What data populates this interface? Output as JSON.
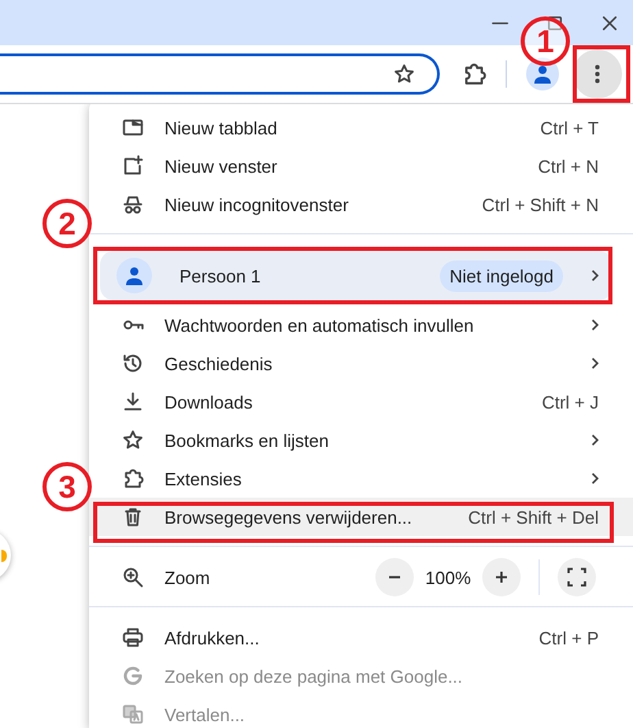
{
  "menu": {
    "items": [
      {
        "kind": "item",
        "label": "Nieuw tabblad",
        "shortcut": "Ctrl + T",
        "submenu": false,
        "highlighted": false,
        "disabled": false
      },
      {
        "kind": "item",
        "label": "Nieuw venster",
        "shortcut": "Ctrl + N",
        "submenu": false,
        "highlighted": false,
        "disabled": false
      },
      {
        "kind": "item",
        "label": "Nieuw incognitovenster",
        "shortcut": "Ctrl + Shift + N",
        "submenu": false,
        "highlighted": false,
        "disabled": false
      },
      {
        "kind": "divider"
      },
      {
        "kind": "profile",
        "name": "Persoon 1",
        "status": "Niet ingelogd",
        "submenu": true
      },
      {
        "kind": "item",
        "label": "Wachtwoorden en automatisch invullen",
        "submenu": true,
        "highlighted": false,
        "disabled": false
      },
      {
        "kind": "item",
        "label": "Geschiedenis",
        "submenu": true,
        "highlighted": false,
        "disabled": false
      },
      {
        "kind": "item",
        "label": "Downloads",
        "shortcut": "Ctrl + J",
        "submenu": false,
        "highlighted": false,
        "disabled": false
      },
      {
        "kind": "item",
        "label": "Bookmarks en lijsten",
        "submenu": true,
        "highlighted": false,
        "disabled": false
      },
      {
        "kind": "item",
        "label": "Extensies",
        "submenu": true,
        "highlighted": false,
        "disabled": false
      },
      {
        "kind": "item",
        "label": "Browsegegevens verwijderen...",
        "shortcut": "Ctrl + Shift + Del",
        "submenu": false,
        "highlighted": true,
        "disabled": false
      },
      {
        "kind": "divider"
      },
      {
        "kind": "zoom",
        "label": "Zoom",
        "value": "100%"
      },
      {
        "kind": "divider"
      },
      {
        "kind": "item",
        "label": "Afdrukken...",
        "shortcut": "Ctrl + P",
        "submenu": false,
        "highlighted": false,
        "disabled": false
      },
      {
        "kind": "item",
        "label": "Zoeken op deze pagina met Google...",
        "submenu": false,
        "highlighted": false,
        "disabled": true
      },
      {
        "kind": "item",
        "label": "Vertalen...",
        "submenu": false,
        "highlighted": false,
        "disabled": true
      }
    ]
  },
  "annotations": [
    {
      "label": "1"
    },
    {
      "label": "2"
    },
    {
      "label": "3"
    }
  ]
}
